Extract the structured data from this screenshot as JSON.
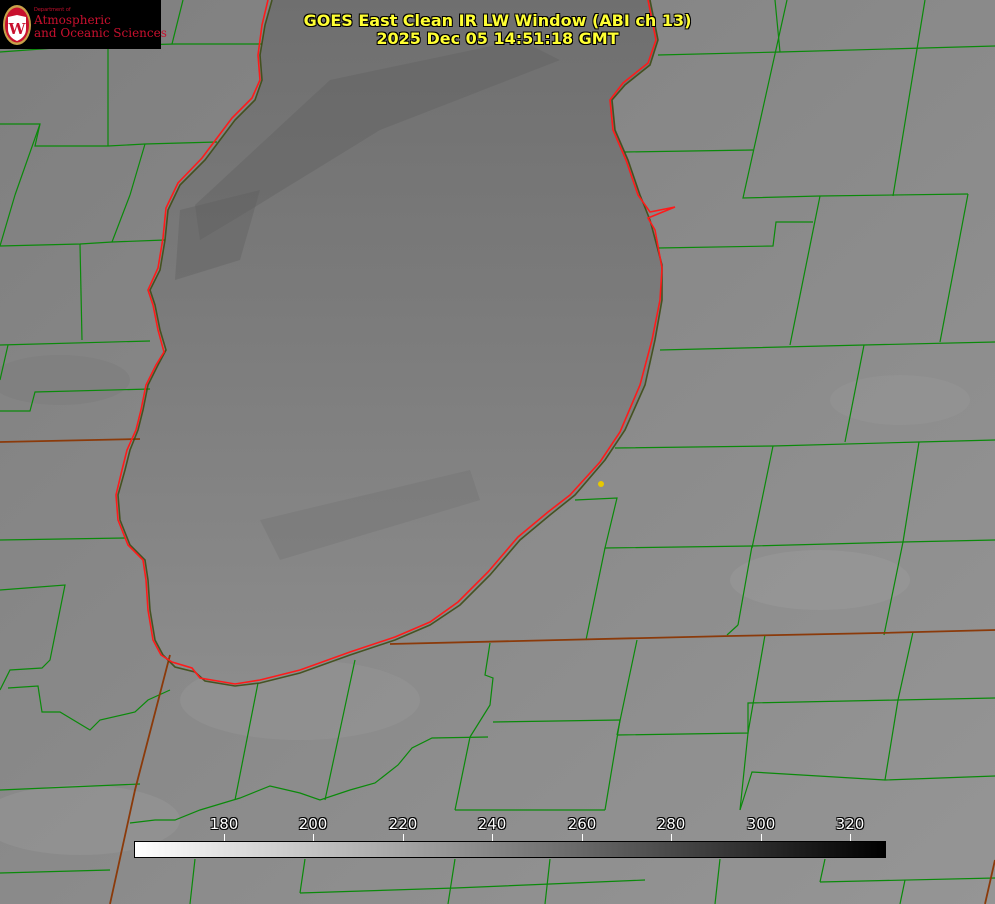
{
  "map": {
    "title_line1": "GOES East Clean IR LW Window (ABI ch 13)",
    "title_line2": "2025 Dec 05 14:51:18 GMT",
    "colors": {
      "title_text": "#ffff33",
      "county_lines": "#0a8a0a",
      "state_lines": "#8b3a0a",
      "lake_outline": "#ff1a1a",
      "marker": "#e6c800",
      "logo_text": "#c8102e"
    },
    "marker_icon": "location-dot-icon"
  },
  "logo": {
    "dept": "Department of",
    "line1": "Atmospheric",
    "line2": "and Oceanic Sciences",
    "seal_letter": "W"
  },
  "colorbar": {
    "min": 160,
    "max": 328,
    "unit_note": "",
    "ticks": [
      180,
      200,
      220,
      240,
      260,
      280,
      300,
      320
    ]
  }
}
